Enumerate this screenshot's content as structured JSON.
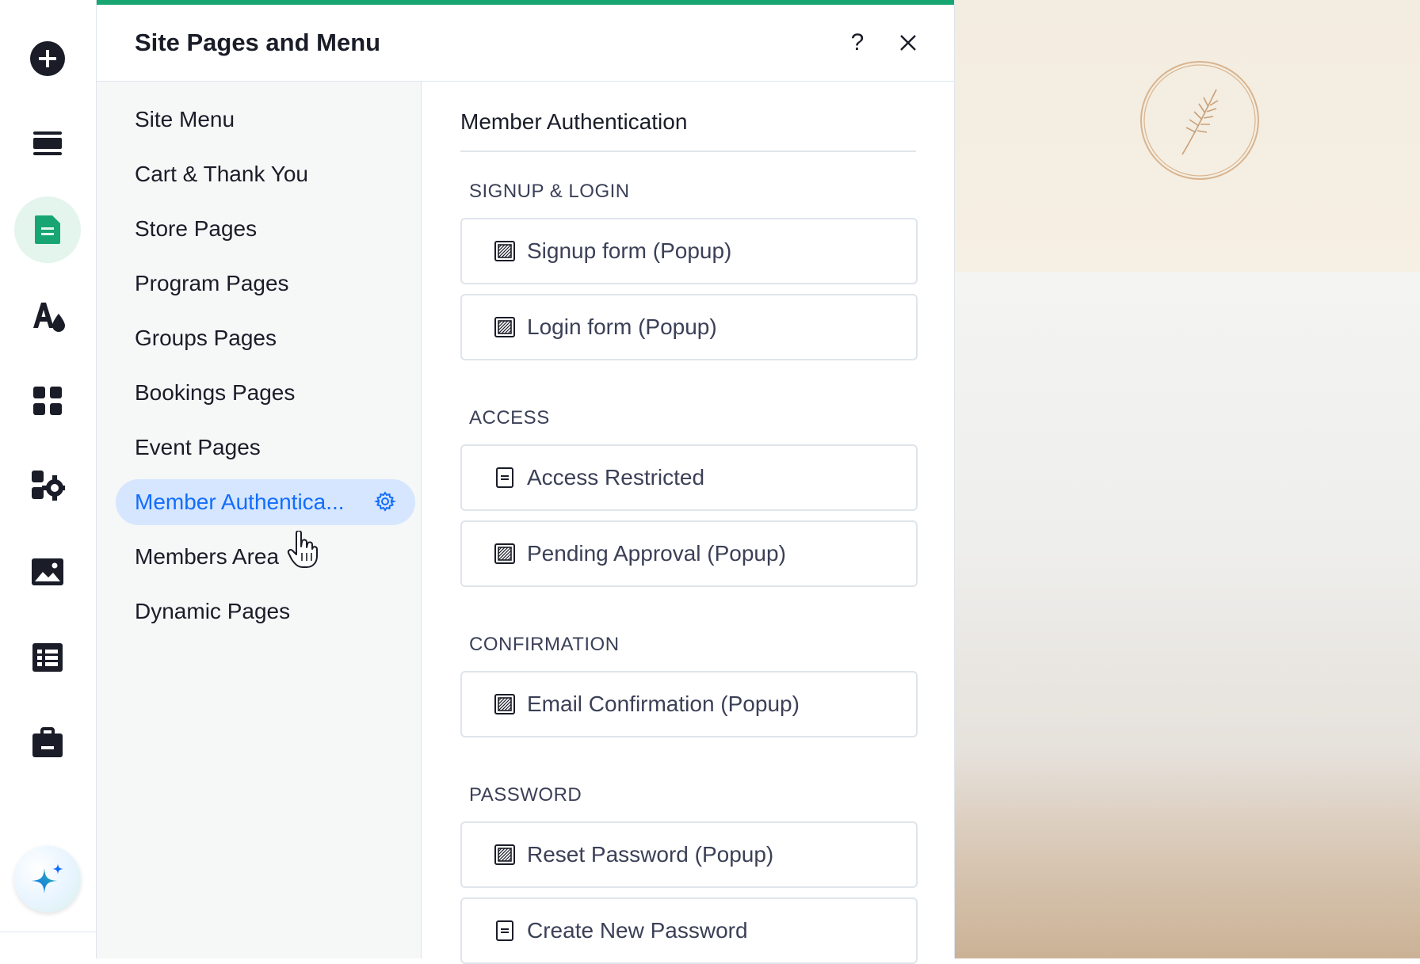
{
  "panel": {
    "title": "Site Pages and Menu",
    "help_label": "?",
    "accent_color": "#17a672",
    "selected_color": "#116dff"
  },
  "rail": {
    "items": [
      {
        "name": "add-elements",
        "icon": "plus-circle-icon"
      },
      {
        "name": "sections",
        "icon": "sections-icon"
      },
      {
        "name": "pages",
        "icon": "page-icon",
        "active": true
      },
      {
        "name": "site-design",
        "icon": "design-icon"
      },
      {
        "name": "apps",
        "icon": "apps-grid-icon"
      },
      {
        "name": "add-apps",
        "icon": "puzzle-icon"
      },
      {
        "name": "media",
        "icon": "image-icon"
      },
      {
        "name": "cms",
        "icon": "table-icon"
      },
      {
        "name": "business",
        "icon": "briefcase-icon"
      },
      {
        "name": "ai",
        "icon": "sparkle-icon"
      }
    ]
  },
  "nav": {
    "items": [
      {
        "label": "Site Menu"
      },
      {
        "label": "Cart & Thank You"
      },
      {
        "label": "Store Pages"
      },
      {
        "label": "Program Pages"
      },
      {
        "label": "Groups Pages"
      },
      {
        "label": "Bookings Pages"
      },
      {
        "label": "Event Pages"
      },
      {
        "label": "Member Authentica...",
        "selected": true
      },
      {
        "label": "Members Area"
      },
      {
        "label": "Dynamic Pages"
      }
    ]
  },
  "content": {
    "title": "Member Authentication",
    "groups": [
      {
        "label": "SIGNUP & LOGIN",
        "pages": [
          {
            "label": "Signup form (Popup)",
            "icon": "popup-icon"
          },
          {
            "label": "Login form (Popup)",
            "icon": "popup-icon"
          }
        ]
      },
      {
        "label": "ACCESS",
        "pages": [
          {
            "label": "Access Restricted",
            "icon": "page-icon"
          },
          {
            "label": "Pending Approval (Popup)",
            "icon": "popup-icon"
          }
        ]
      },
      {
        "label": "CONFIRMATION",
        "pages": [
          {
            "label": "Email Confirmation (Popup)",
            "icon": "popup-icon"
          }
        ]
      },
      {
        "label": "PASSWORD",
        "pages": [
          {
            "label": "Reset Password (Popup)",
            "icon": "popup-icon"
          },
          {
            "label": "Create New Password",
            "icon": "page-icon"
          }
        ]
      }
    ]
  }
}
